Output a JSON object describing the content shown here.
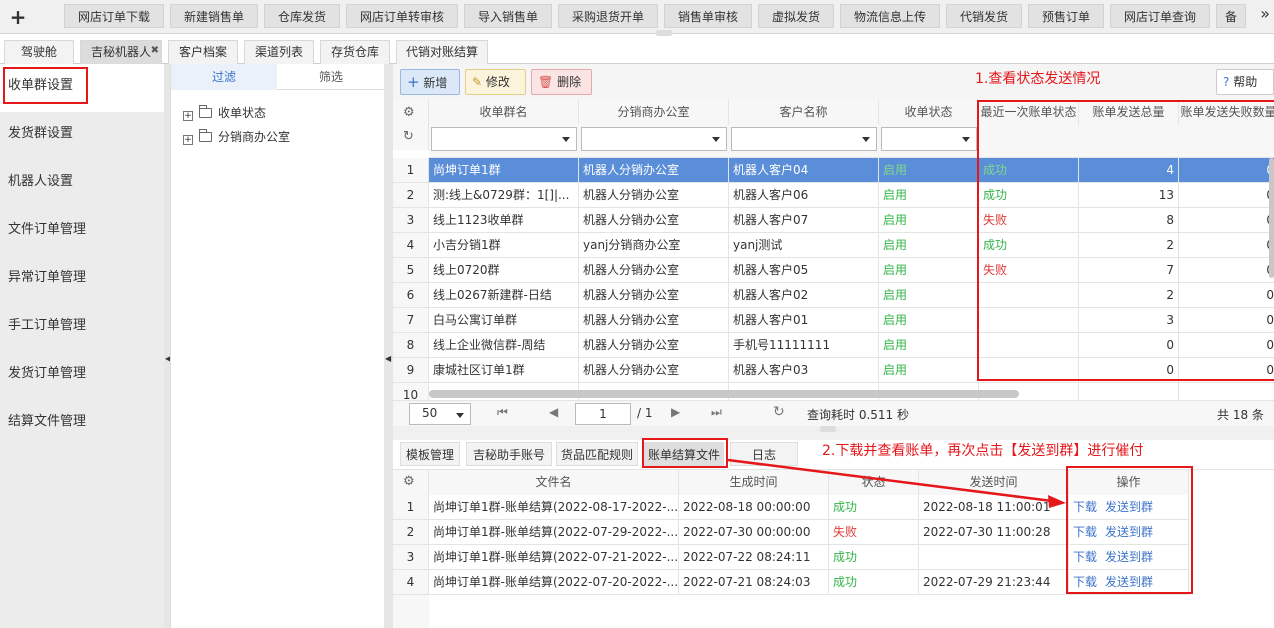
{
  "top_tabs": [
    "网店订单下载",
    "新建销售单",
    "仓库发货",
    "网店订单转审核",
    "导入销售单",
    "采购退货开单",
    "销售单审核",
    "虚拟发货",
    "物流信息上传",
    "代销发货",
    "预售订单",
    "网店订单查询",
    "备"
  ],
  "main_tabs": [
    "驾驶舱",
    "吉秘机器人",
    "客户档案",
    "渠道列表",
    "存货仓库",
    "代销对账结算"
  ],
  "left_nav": [
    "收单群设置",
    "发货群设置",
    "机器人设置",
    "文件订单管理",
    "异常订单管理",
    "手工订单管理",
    "发货订单管理",
    "结算文件管理"
  ],
  "filter": {
    "tab_filter": "过滤",
    "tab_select": "筛选",
    "tree": [
      "收单状态",
      "分销商办公室"
    ]
  },
  "toolbar": {
    "add": "新增",
    "edit": "修改",
    "delete": "删除",
    "help": "帮助"
  },
  "grid": {
    "headers": [
      "收单群名",
      "分销商办公室",
      "客户名称",
      "收单状态",
      "最近一次账单状态",
      "账单发送总量",
      "账单发送失败数量"
    ],
    "rows": [
      [
        "1",
        "尚坤订单1群",
        "机器人分销办公室",
        "机器人客户04",
        "启用",
        "成功",
        "4",
        "0"
      ],
      [
        "2",
        "测:线上&0729群：1[]|...",
        "机器人分销办公室",
        "机器人客户06",
        "启用",
        "成功",
        "13",
        "0"
      ],
      [
        "3",
        "线上1123收单群",
        "机器人分销办公室",
        "机器人客户07",
        "启用",
        "失败",
        "8",
        "0"
      ],
      [
        "4",
        "小吉分销1群",
        "yanj分销商办公室",
        "yanj测试",
        "启用",
        "成功",
        "2",
        "0"
      ],
      [
        "5",
        "线上0720群",
        "机器人分销办公室",
        "机器人客户05",
        "启用",
        "失败",
        "7",
        "0"
      ],
      [
        "6",
        "线上0267新建群-日结",
        "机器人分销办公室",
        "机器人客户02",
        "启用",
        "",
        "2",
        "0"
      ],
      [
        "7",
        "白马公寓订单群",
        "机器人分销办公室",
        "机器人客户01",
        "启用",
        "",
        "3",
        "0"
      ],
      [
        "8",
        "线上企业微信群-周结",
        "机器人分销办公室",
        "手机号11111111",
        "启用",
        "",
        "0",
        "0"
      ],
      [
        "9",
        "康城社区订单1群",
        "机器人分销办公室",
        "机器人客户03",
        "启用",
        "",
        "0",
        "0"
      ],
      [
        "10",
        "",
        "",
        "",
        "",
        "",
        "",
        ""
      ]
    ]
  },
  "pager": {
    "page_size": "50",
    "page": "1",
    "total_pages": "/ 1",
    "query_time": "查询耗时 0.511 秒",
    "total": "共 18 条"
  },
  "bottom_tabs": [
    "模板管理",
    "吉秘助手账号",
    "货品匹配规则",
    "账单结算文件",
    "日志"
  ],
  "bottom_grid": {
    "headers": [
      "文件名",
      "生成时间",
      "状态",
      "发送时间",
      "操作"
    ],
    "rows": [
      [
        "1",
        "尚坤订单1群-账单结算(2022-08-17-2022-...",
        "2022-08-18 00:00:00",
        "成功",
        "2022-08-18 11:00:01"
      ],
      [
        "2",
        "尚坤订单1群-账单结算(2022-07-29-2022-...",
        "2022-07-30 00:00:00",
        "失败",
        "2022-07-30 11:00:28"
      ],
      [
        "3",
        "尚坤订单1群-账单结算(2022-07-21-2022-...",
        "2022-07-22 08:24:11",
        "成功",
        ""
      ],
      [
        "4",
        "尚坤订单1群-账单结算(2022-07-20-2022-...",
        "2022-07-21 08:24:03",
        "成功",
        "2022-07-29 21:23:44"
      ]
    ],
    "action_download": "下载",
    "action_send": "发送到群"
  },
  "annotations": {
    "a1": "1.查看状态发送情况",
    "a2": "2.下载并查看账单，再次点击【发送到群】进行催付"
  },
  "colors": {
    "annotation_red": "#e5171b",
    "selected_row": "#5b8ed8",
    "success": "#35b54a",
    "fail": "#e03a3a",
    "link": "#3d73c9"
  }
}
